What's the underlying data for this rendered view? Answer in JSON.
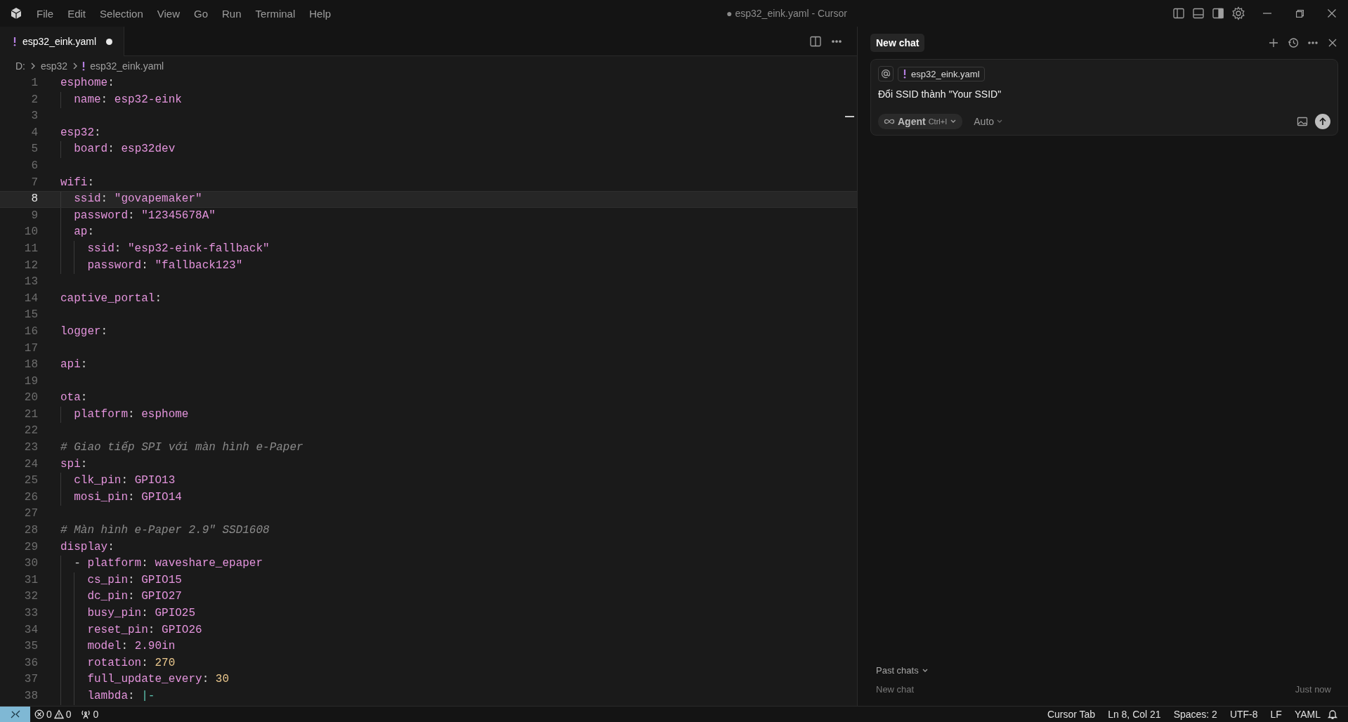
{
  "menu_bar": {
    "items": [
      "File",
      "Edit",
      "Selection",
      "View",
      "Go",
      "Run",
      "Terminal",
      "Help"
    ],
    "title": "● esp32_eink.yaml - Cursor"
  },
  "tabs": [
    {
      "label": "esp32_eink.yaml",
      "selected": true,
      "modified": true
    }
  ],
  "breadcrumb": [
    "D:",
    "esp32",
    "esp32_eink.yaml"
  ],
  "editor": {
    "lines": [
      {
        "n": "1",
        "current": false,
        "parts": [
          {
            "kind": "key",
            "text": "esphome"
          },
          {
            "kind": "punct",
            "text": ":"
          }
        ]
      },
      {
        "n": "2",
        "current": false,
        "parts": [
          {
            "kind": "key",
            "text": "  name"
          },
          {
            "kind": "punct",
            "text": ": "
          },
          {
            "kind": "value",
            "text": "esp32-eink"
          }
        ]
      },
      {
        "n": "3",
        "current": false
      },
      {
        "n": "4",
        "current": false,
        "parts": [
          {
            "kind": "key",
            "text": "esp32"
          },
          {
            "kind": "punct",
            "text": ":"
          }
        ]
      },
      {
        "n": "5",
        "current": false,
        "parts": [
          {
            "kind": "key",
            "text": "  board"
          },
          {
            "kind": "punct",
            "text": ": "
          },
          {
            "kind": "value",
            "text": "esp32dev"
          }
        ]
      },
      {
        "n": "6",
        "current": false
      },
      {
        "n": "7",
        "current": false,
        "parts": [
          {
            "kind": "key",
            "text": "wifi"
          },
          {
            "kind": "punct",
            "text": ":"
          }
        ]
      },
      {
        "n": "8",
        "current": true,
        "parts": [
          {
            "kind": "key",
            "text": "  ssid"
          },
          {
            "kind": "punct",
            "text": ": "
          },
          {
            "kind": "value",
            "text": "\"govapemaker\""
          }
        ]
      },
      {
        "n": "9",
        "current": false,
        "parts": [
          {
            "kind": "key",
            "text": "  password"
          },
          {
            "kind": "punct",
            "text": ": "
          },
          {
            "kind": "value",
            "text": "\"12345678A\""
          }
        ]
      },
      {
        "n": "10",
        "current": false,
        "parts": [
          {
            "kind": "key",
            "text": "  ap"
          },
          {
            "kind": "punct",
            "text": ":"
          }
        ]
      },
      {
        "n": "11",
        "current": false,
        "parts": [
          {
            "kind": "key",
            "text": "    ssid"
          },
          {
            "kind": "punct",
            "text": ": "
          },
          {
            "kind": "value",
            "text": "\"esp32-eink-fallback\""
          }
        ]
      },
      {
        "n": "12",
        "current": false,
        "parts": [
          {
            "kind": "key",
            "text": "    password"
          },
          {
            "kind": "punct",
            "text": ": "
          },
          {
            "kind": "value",
            "text": "\"fallback123\""
          }
        ]
      },
      {
        "n": "13",
        "current": false
      },
      {
        "n": "14",
        "current": false,
        "parts": [
          {
            "kind": "key",
            "text": "captive_portal"
          },
          {
            "kind": "punct",
            "text": ":"
          }
        ]
      },
      {
        "n": "15",
        "current": false
      },
      {
        "n": "16",
        "current": false,
        "parts": [
          {
            "kind": "key",
            "text": "logger"
          },
          {
            "kind": "punct",
            "text": ":"
          }
        ]
      },
      {
        "n": "17",
        "current": false
      },
      {
        "n": "18",
        "current": false,
        "parts": [
          {
            "kind": "key",
            "text": "api"
          },
          {
            "kind": "punct",
            "text": ":"
          }
        ]
      },
      {
        "n": "19",
        "current": false
      },
      {
        "n": "20",
        "current": false,
        "parts": [
          {
            "kind": "key",
            "text": "ota"
          },
          {
            "kind": "punct",
            "text": ":"
          }
        ]
      },
      {
        "n": "21",
        "current": false,
        "parts": [
          {
            "kind": "key",
            "text": "  platform"
          },
          {
            "kind": "punct",
            "text": ": "
          },
          {
            "kind": "value",
            "text": "esphome"
          }
        ]
      },
      {
        "n": "22",
        "current": false
      },
      {
        "n": "23",
        "current": false,
        "parts": [
          {
            "kind": "comment",
            "text": "# Giao tiếp SPI với màn hình e-Paper"
          }
        ]
      },
      {
        "n": "24",
        "current": false,
        "parts": [
          {
            "kind": "key",
            "text": "spi"
          },
          {
            "kind": "punct",
            "text": ":"
          }
        ]
      },
      {
        "n": "25",
        "current": false,
        "parts": [
          {
            "kind": "key",
            "text": "  clk_pin"
          },
          {
            "kind": "punct",
            "text": ": "
          },
          {
            "kind": "value",
            "text": "GPIO13"
          }
        ]
      },
      {
        "n": "26",
        "current": false,
        "parts": [
          {
            "kind": "key",
            "text": "  mosi_pin"
          },
          {
            "kind": "punct",
            "text": ": "
          },
          {
            "kind": "value",
            "text": "GPIO14"
          }
        ]
      },
      {
        "n": "27",
        "current": false
      },
      {
        "n": "28",
        "current": false,
        "parts": [
          {
            "kind": "comment",
            "text": "# Màn hình e-Paper 2.9\" SSD1608"
          }
        ]
      },
      {
        "n": "29",
        "current": false,
        "parts": [
          {
            "kind": "key",
            "text": "display"
          },
          {
            "kind": "punct",
            "text": ":"
          }
        ]
      },
      {
        "n": "30",
        "current": false,
        "parts": [
          {
            "kind": "punct",
            "text": "  - "
          },
          {
            "kind": "key",
            "text": "platform"
          },
          {
            "kind": "punct",
            "text": ": "
          },
          {
            "kind": "value",
            "text": "waveshare_epaper"
          }
        ]
      },
      {
        "n": "31",
        "current": false,
        "parts": [
          {
            "kind": "key",
            "text": "    cs_pin"
          },
          {
            "kind": "punct",
            "text": ": "
          },
          {
            "kind": "value",
            "text": "GPIO15"
          }
        ]
      },
      {
        "n": "32",
        "current": false,
        "parts": [
          {
            "kind": "key",
            "text": "    dc_pin"
          },
          {
            "kind": "punct",
            "text": ": "
          },
          {
            "kind": "value",
            "text": "GPIO27"
          }
        ]
      },
      {
        "n": "33",
        "current": false,
        "parts": [
          {
            "kind": "key",
            "text": "    busy_pin"
          },
          {
            "kind": "punct",
            "text": ": "
          },
          {
            "kind": "value",
            "text": "GPIO25"
          }
        ]
      },
      {
        "n": "34",
        "current": false,
        "parts": [
          {
            "kind": "key",
            "text": "    reset_pin"
          },
          {
            "kind": "punct",
            "text": ": "
          },
          {
            "kind": "value",
            "text": "GPIO26"
          }
        ]
      },
      {
        "n": "35",
        "current": false,
        "parts": [
          {
            "kind": "key",
            "text": "    model"
          },
          {
            "kind": "punct",
            "text": ": "
          },
          {
            "kind": "value",
            "text": "2.90in"
          }
        ]
      },
      {
        "n": "36",
        "current": false,
        "parts": [
          {
            "kind": "key",
            "text": "    rotation"
          },
          {
            "kind": "punct",
            "text": ": "
          },
          {
            "kind": "number",
            "text": "270"
          }
        ]
      },
      {
        "n": "37",
        "current": false,
        "parts": [
          {
            "kind": "key",
            "text": "    full_update_every"
          },
          {
            "kind": "punct",
            "text": ": "
          },
          {
            "kind": "number",
            "text": "30"
          }
        ]
      },
      {
        "n": "38",
        "current": false,
        "parts": [
          {
            "kind": "key",
            "text": "    lambda"
          },
          {
            "kind": "punct",
            "text": ": "
          },
          {
            "kind": "block",
            "text": "|-"
          }
        ]
      }
    ]
  },
  "chat": {
    "tab": "New chat",
    "context_chip": "esp32_eink.yaml",
    "message": "Đổi SSID thành \"Your SSID\"",
    "mode": "Agent",
    "shortcut": "Ctrl+I",
    "model": "Auto",
    "past_chats_label": "Past chats",
    "past_chats": [
      {
        "title": "New chat",
        "time": "Just now"
      }
    ]
  },
  "status_bar": {
    "errors": "0",
    "warnings": "0",
    "ports": "0",
    "items": [
      "Cursor Tab",
      "Ln 8, Col 21",
      "Spaces: 2",
      "UTF-8",
      "LF",
      "YAML"
    ]
  }
}
